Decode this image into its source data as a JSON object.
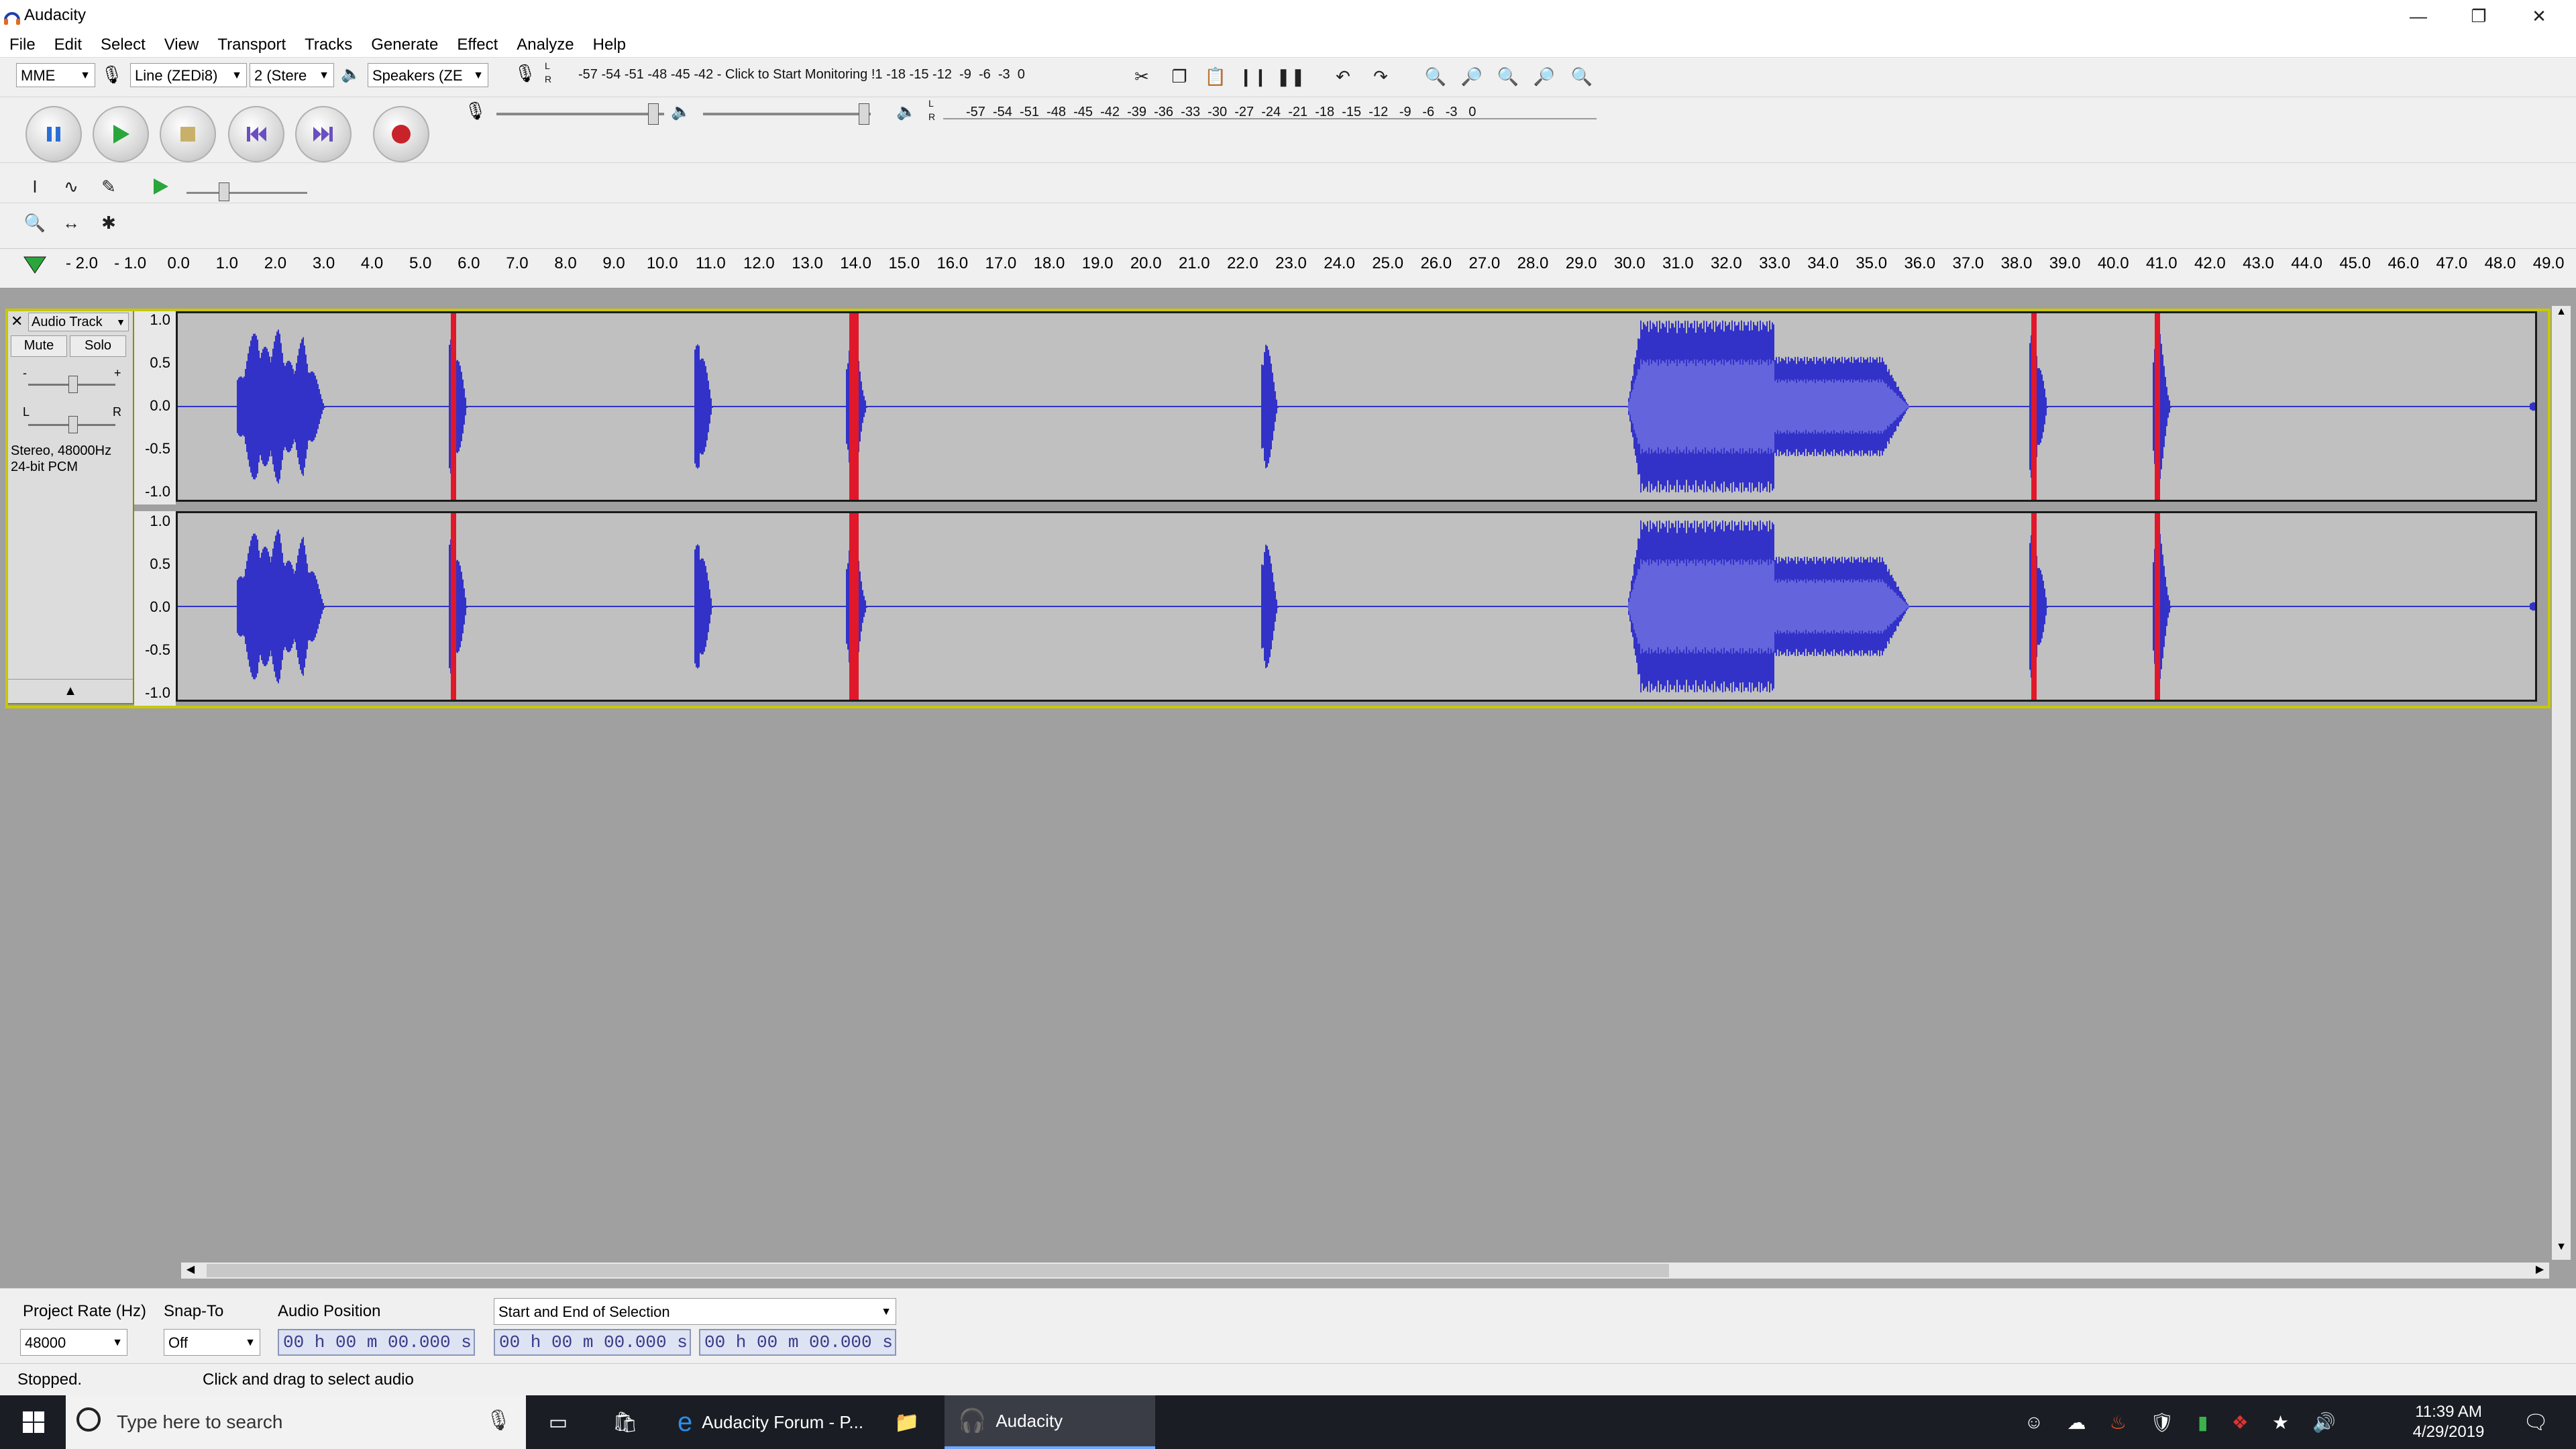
{
  "window": {
    "title": "Audacity",
    "controls": [
      "minimize-icon",
      "restore-icon",
      "close-icon"
    ]
  },
  "menu": [
    "File",
    "Edit",
    "Select",
    "View",
    "Transport",
    "Tracks",
    "Generate",
    "Effect",
    "Analyze",
    "Help"
  ],
  "device_toolbar": {
    "host": "MME",
    "recording_device": "Line (ZEDi8)",
    "channels": "2 (Stere",
    "playback_device": "Speakers (ZE"
  },
  "record_meter": {
    "ticks": "-57 -54 -51 -48 -45 -42 -",
    "prompt": "Click to Start Monitoring",
    "ticks_tail": "!1 -18 -15 -12  -9  -6  -3  0"
  },
  "play_meter": {
    "ticks": "-57  -54  -51  -48  -45  -42  -39  -36  -33  -30  -27  -24  -21  -18  -15  -12   -9   -6   -3   0",
    "lr": "L\nR"
  },
  "ruler": {
    "ticks": [
      "- 2.0",
      "- 1.0",
      "0.0",
      "1.0",
      "2.0",
      "3.0",
      "4.0",
      "5.0",
      "6.0",
      "7.0",
      "8.0",
      "9.0",
      "10.0",
      "11.0",
      "12.0",
      "13.0",
      "14.0",
      "15.0",
      "16.0",
      "17.0",
      "18.0",
      "19.0",
      "20.0",
      "21.0",
      "22.0",
      "23.0",
      "24.0",
      "25.0",
      "26.0",
      "27.0",
      "28.0",
      "29.0",
      "30.0",
      "31.0",
      "32.0",
      "33.0",
      "34.0",
      "35.0",
      "36.0",
      "37.0",
      "38.0",
      "39.0",
      "40.0",
      "41.0",
      "42.0",
      "43.0",
      "44.0",
      "45.0",
      "46.0",
      "47.0",
      "48.0",
      "49.0"
    ]
  },
  "track": {
    "name": "Audio Track",
    "mute": "Mute",
    "solo": "Solo",
    "gain_minus": "-",
    "gain_plus": "+",
    "pan_l": "L",
    "pan_r": "R",
    "info_line1": "Stereo, 48000Hz",
    "info_line2": "24-bit PCM",
    "scale": [
      "1.0",
      "0.5",
      "0.0",
      "-0.5",
      "-1.0"
    ]
  },
  "selection_toolbar": {
    "project_rate_label": "Project Rate (Hz)",
    "project_rate_value": "48000",
    "snap_label": "Snap-To",
    "snap_value": "Off",
    "audio_position_label": "Audio Position",
    "audio_position_value": "00 h 00 m 00.000 s",
    "selection_mode": "Start and End of Selection",
    "selection_start": "00 h 00 m 00.000 s",
    "selection_end": "00 h 00 m 00.000 s"
  },
  "statusbar": {
    "state": "Stopped.",
    "hint": "Click and drag to select audio"
  },
  "taskbar": {
    "search_placeholder": "Type here to search",
    "apps": [
      "Audacity Forum - P...",
      "Audacity"
    ],
    "time": "11:39 AM",
    "date": "4/29/2019"
  },
  "colors": {
    "waveform": "#3232c8",
    "waveform_rms": "#6464dc",
    "clip": "#e0182a",
    "track_border": "#8b8b00"
  }
}
